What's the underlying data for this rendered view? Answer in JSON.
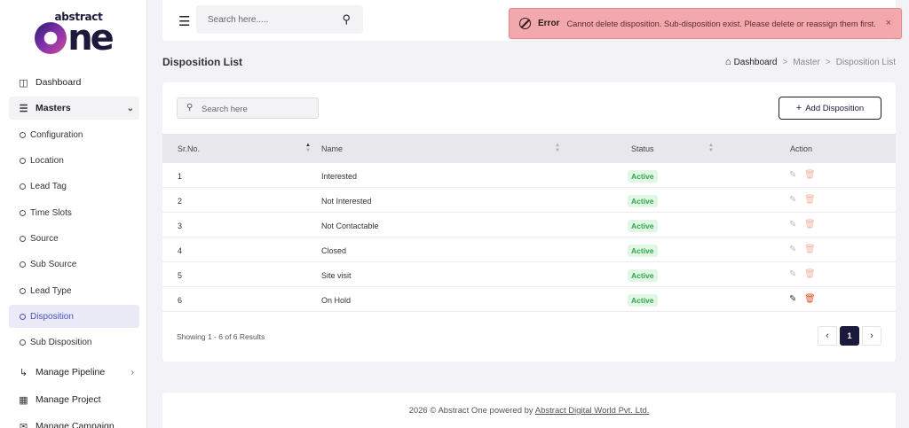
{
  "brand": {
    "top": "abstract",
    "main": "ne"
  },
  "sidebar": {
    "items": [
      {
        "label": "Dashboard",
        "icon": "grid-icon"
      },
      {
        "label": "Masters",
        "icon": "list-icon"
      },
      {
        "label": "Manage Pipeline",
        "icon": "pipeline-icon"
      },
      {
        "label": "Manage Project",
        "icon": "building-icon"
      },
      {
        "label": "Manage Campaign",
        "icon": "campaign-icon"
      }
    ],
    "masters_sub": [
      {
        "label": "Configuration"
      },
      {
        "label": "Location"
      },
      {
        "label": "Lead Tag"
      },
      {
        "label": "Time Slots"
      },
      {
        "label": "Source"
      },
      {
        "label": "Sub Source"
      },
      {
        "label": "Lead Type"
      },
      {
        "label": "Disposition"
      },
      {
        "label": "Sub Disposition"
      }
    ]
  },
  "header": {
    "search_placeholder": "Search here....."
  },
  "toast": {
    "title": "Error",
    "message": "Cannot delete disposition. Sub-disposition exist. Please delete or reassign them first.",
    "close": "×"
  },
  "page": {
    "title": "Disposition List",
    "breadcrumb": [
      "Dashboard",
      "Master",
      "Disposition List"
    ]
  },
  "card": {
    "search_placeholder": "Search here",
    "add_label": "Add Disposition",
    "columns": [
      "Sr.No.",
      "Name",
      "Status",
      "Action"
    ],
    "rows": [
      {
        "sr": "1",
        "name": "Interested",
        "status": "Active"
      },
      {
        "sr": "2",
        "name": "Not Interested",
        "status": "Active"
      },
      {
        "sr": "3",
        "name": "Not Contactable",
        "status": "Active"
      },
      {
        "sr": "4",
        "name": "Closed",
        "status": "Active"
      },
      {
        "sr": "5",
        "name": "Site visit",
        "status": "Active"
      },
      {
        "sr": "6",
        "name": "On Hold",
        "status": "Active"
      }
    ],
    "showing": "Showing 1 - 6 of 6 Results",
    "page": "1"
  },
  "footer": {
    "text": "2026 © Abstract One powered by ",
    "link": "Abstract Digital World Pvt. Ltd."
  }
}
